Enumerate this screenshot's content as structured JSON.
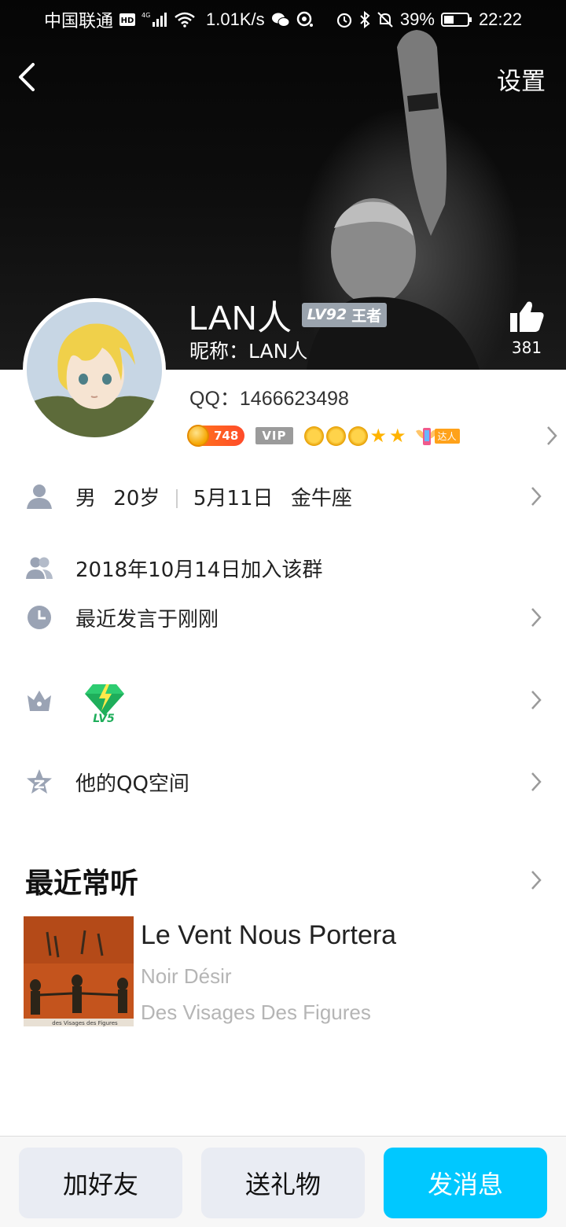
{
  "status_bar": {
    "carrier": "中国联通",
    "hd_badge": "HD",
    "network": "4G",
    "speed": "1.01K/s",
    "battery": "39%",
    "time": "22:22"
  },
  "header": {
    "settings_label": "设置"
  },
  "profile": {
    "name": "LAN人",
    "level_prefix": "LV92",
    "level_title": "王者",
    "nickname_label": "昵称：",
    "nickname": "LAN人",
    "qq_label": "QQ：",
    "qq_number": "1466623498",
    "likes": "381",
    "coin_value": "748",
    "vip_label": "VIP",
    "talent_label": "达人"
  },
  "info": {
    "gender": "男",
    "age": "20岁",
    "birthday": "5月11日",
    "zodiac": "金牛座",
    "joined": "2018年10月14日加入该群",
    "last_spoke": "最近发言于刚刚",
    "game_level": "LV5",
    "qzone": "他的QQ空间"
  },
  "music": {
    "section_title": "最近常听",
    "song_title": "Le Vent Nous Portera",
    "artist": "Noir Désir",
    "album": "Des Visages Des Figures",
    "cover_text": "des Visages des Figures"
  },
  "actions": {
    "add_friend": "加好友",
    "send_gift": "送礼物",
    "send_message": "发消息"
  },
  "colors": {
    "accent": "#00c8ff",
    "secondary_button": "#e9ecf3",
    "level_badge": "#9aa3ad",
    "coin_badge": "#ff5a22"
  }
}
